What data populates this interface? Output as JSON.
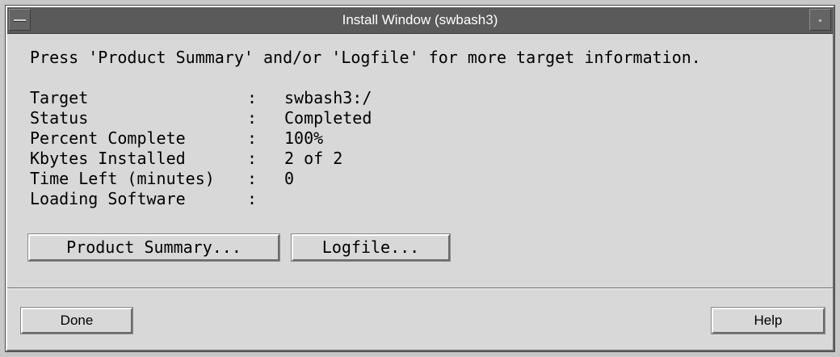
{
  "window": {
    "title": "Install Window (swbash3)"
  },
  "instructions": "Press 'Product Summary' and/or 'Logfile' for more target information.",
  "info": [
    {
      "label": "Target",
      "separator": ":",
      "value": "swbash3:/"
    },
    {
      "label": "Status",
      "separator": ":",
      "value": "Completed"
    },
    {
      "label": "Percent Complete",
      "separator": ":",
      "value": "100%"
    },
    {
      "label": "Kbytes Installed",
      "separator": ":",
      "value": "2 of 2"
    },
    {
      "label": "Time Left (minutes)",
      "separator": ":",
      "value": "0"
    },
    {
      "label": "Loading Software",
      "separator": ":",
      "value": ""
    }
  ],
  "buttons": {
    "product_summary": "Product Summary...",
    "logfile": "Logfile...",
    "done": "Done",
    "help": "Help"
  },
  "colors": {
    "background": "#d8d8d8",
    "titlebar": "#5a5a5a",
    "title_text": "#ffffff"
  },
  "icons": {
    "window_menu": "window-menu-icon",
    "minimize": "minimize-icon"
  }
}
